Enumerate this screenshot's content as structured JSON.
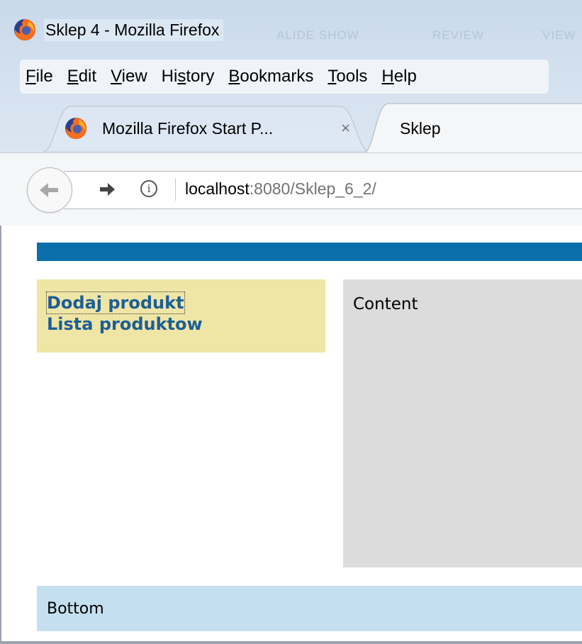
{
  "window": {
    "title": "Sklep 4 - Mozilla Firefox"
  },
  "menu": {
    "items": [
      {
        "key": "F",
        "rest": "ile"
      },
      {
        "key": "E",
        "rest": "dit"
      },
      {
        "key": "V",
        "rest": "iew"
      },
      {
        "pre": "Hi",
        "key": "s",
        "rest": "tory"
      },
      {
        "key": "B",
        "rest": "ookmarks"
      },
      {
        "key": "T",
        "rest": "ools"
      },
      {
        "key": "H",
        "rest": "elp"
      }
    ]
  },
  "tabs": [
    {
      "label": "Mozilla Firefox Start P...",
      "active": false,
      "close": "×"
    },
    {
      "label": "Sklep",
      "active": true
    }
  ],
  "navbar": {
    "url_host": "localhost",
    "url_rest": ":8080/Sklep_6_2/"
  },
  "page": {
    "sidebar": {
      "links": [
        "Dodaj produkt",
        "Lista produktow"
      ]
    },
    "content": {
      "label": "Content"
    },
    "bottom": {
      "label": "Bottom"
    }
  },
  "colors": {
    "header_bar": "#0a6fab",
    "sidebar_bg": "#efe5a5",
    "link": "#1c5e96",
    "content_bg": "#dcdcdc",
    "bottom_bg": "#c4dff0"
  },
  "icons": {
    "app": "firefox-logo-icon",
    "back": "arrow-left-icon",
    "forward": "arrow-right-icon",
    "site_info": "info-icon",
    "close_tab": "close-icon"
  }
}
